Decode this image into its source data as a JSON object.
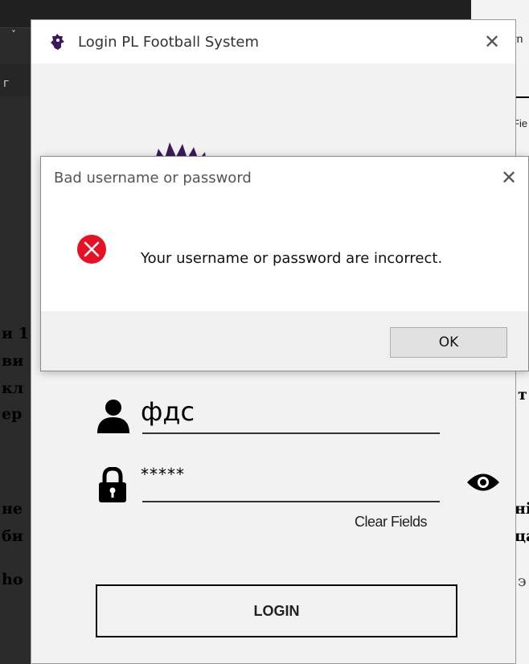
{
  "background": {
    "left_fragments": [
      "и 1",
      "ви",
      "кл",
      "ер",
      "не",
      "би",
      "ho"
    ],
    "right_fragments": [
      "т",
      "ні",
      "ца",
      "э"
    ],
    "top_right_text": "rn",
    "top_right_text2": "Fie",
    "top_letter": "г",
    "chevron": "˅"
  },
  "login_window": {
    "title": "Login PL Football System",
    "close_glyph": "✕",
    "username_value": "фдс",
    "password_value": "*****",
    "clear_fields_label": "Clear Fields",
    "login_label": "LOGIN",
    "icons": {
      "title": "premier-league-lion-icon",
      "user": "user-icon",
      "lock": "lock-icon",
      "eye": "eye-icon"
    },
    "brand_color": "#3d195b"
  },
  "dialog": {
    "title": "Bad username or password",
    "close_glyph": "✕",
    "message": "Your username or password are incorrect.",
    "ok_label": "OK",
    "error_color": "#e81123"
  }
}
